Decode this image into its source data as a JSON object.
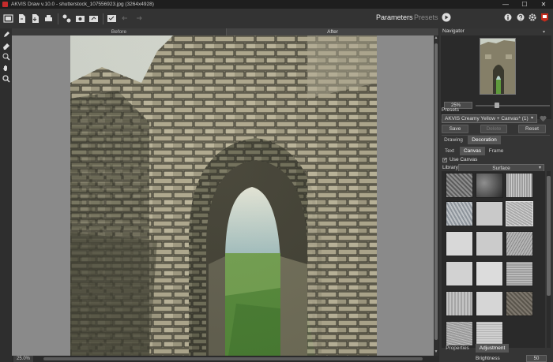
{
  "window": {
    "title": "AKVIS Draw v.10.0 - shutterstock_107556923.jpg (3264x4928)",
    "minimize_glyph": "—",
    "maximize_glyph": "☐",
    "close_glyph": "✕"
  },
  "toolbar": {
    "parameters_label": "Parameters",
    "presets_label": "Presets",
    "icons": [
      "home-icon",
      "open-file-icon",
      "save-icon",
      "print-icon",
      "batch-icon",
      "plugin-icon",
      "share-icon",
      "apply-icon",
      "undo-icon",
      "redo-icon",
      "run-icon",
      "info-icon",
      "help-icon",
      "settings-icon",
      "akvis-icon"
    ]
  },
  "canvas": {
    "before_label": "Before",
    "after_label": "After"
  },
  "status": {
    "zoom": "25.0%"
  },
  "navigator": {
    "title": "Navigator",
    "zoom": "25%"
  },
  "presets": {
    "title": "Presets",
    "selected": "AKVIS Creamy Yellow + Canvas* (1)",
    "save_label": "Save",
    "delete_label": "Delete",
    "reset_label": "Reset"
  },
  "tabs": {
    "drawing": "Drawing",
    "decoration": "Decoration"
  },
  "subtabs": {
    "text": "Text",
    "canvas": "Canvas",
    "frame": "Frame"
  },
  "canvas_settings": {
    "use_canvas_label": "Use Canvas",
    "use_canvas_checked": "✓",
    "library_label": "Library",
    "library_value": "Surface"
  },
  "bottom_tabs": {
    "properties": "Properties",
    "adjustment": "Adjustment"
  },
  "brightness": {
    "label": "Brightness",
    "value": "50"
  },
  "colors": {
    "accent": "#5a5a5a",
    "close_red": "#c42b1c"
  }
}
